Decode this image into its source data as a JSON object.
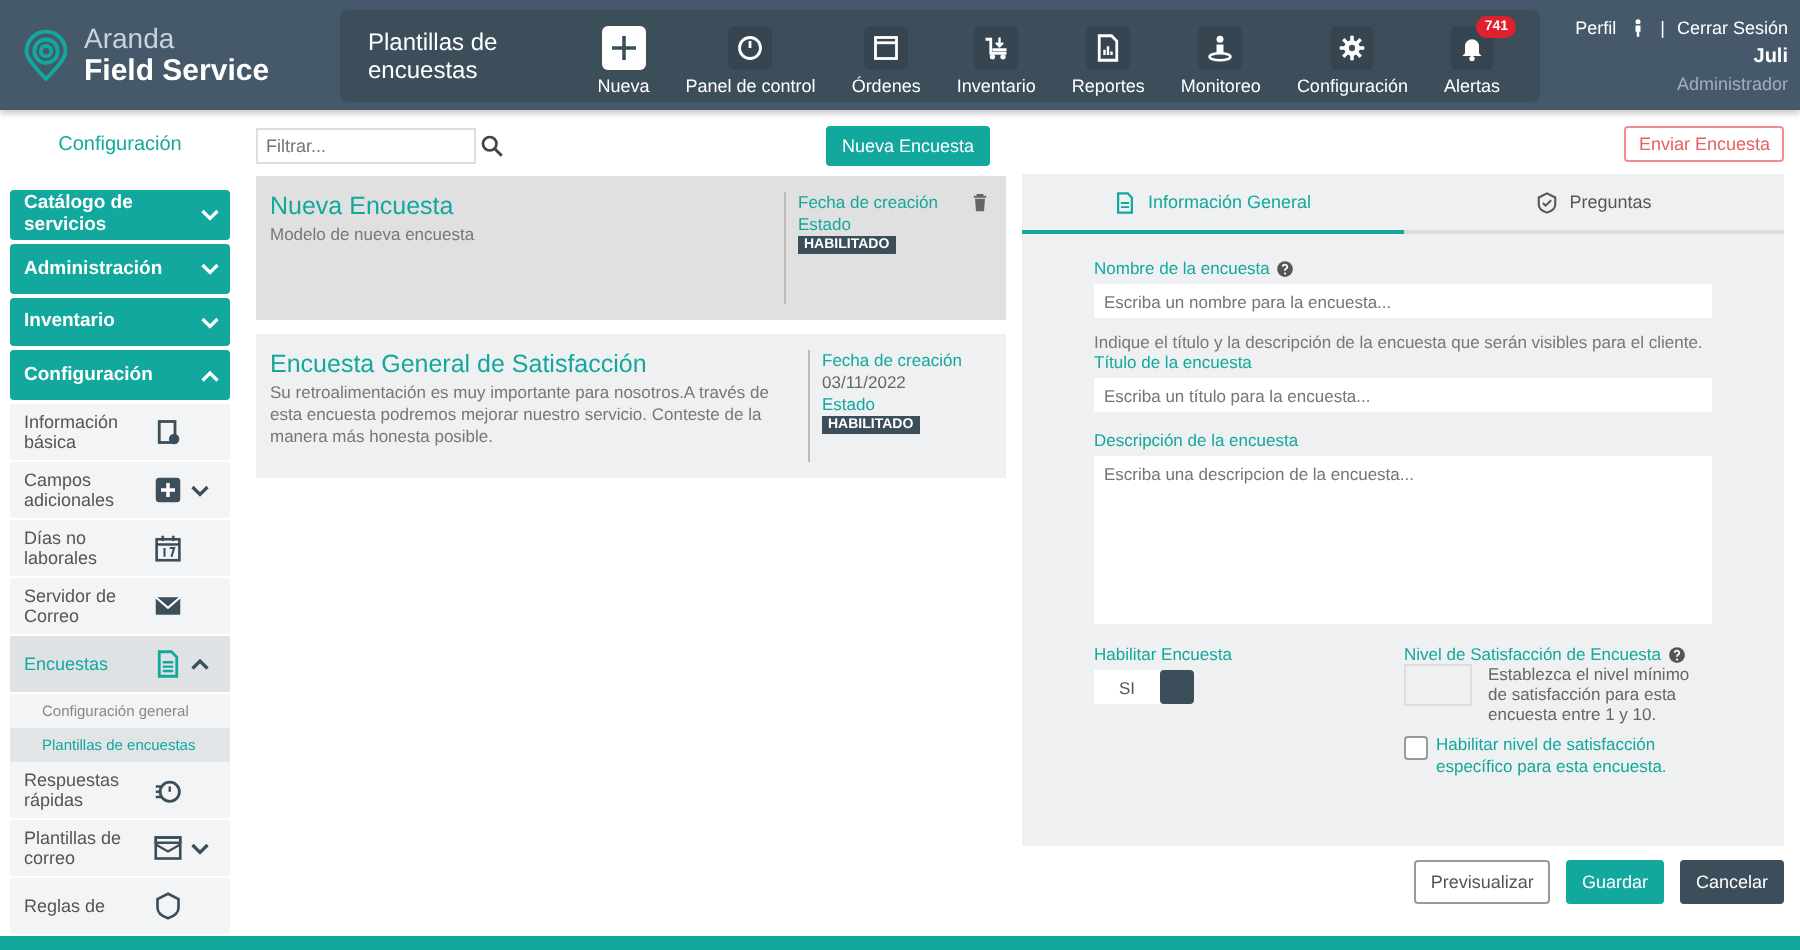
{
  "header": {
    "logo": {
      "line1": "Aranda",
      "line2": "Field Service"
    },
    "page_title": "Plantillas de encuestas",
    "nav": [
      {
        "kind": "add",
        "label": "Nueva"
      },
      {
        "kind": "dashboard",
        "label": "Panel de control"
      },
      {
        "kind": "orders",
        "label": "Órdenes"
      },
      {
        "kind": "inventory",
        "label": "Inventario"
      },
      {
        "kind": "reports",
        "label": "Reportes"
      },
      {
        "kind": "monitor",
        "label": "Monitoreo"
      },
      {
        "kind": "settings",
        "label": "Configuración"
      },
      {
        "kind": "alerts",
        "label": "Alertas",
        "badge": "741"
      }
    ],
    "user": {
      "profile": "Perfil",
      "separator": "|",
      "logout": "Cerrar Sesión",
      "name": "Juli",
      "role": "Administrador"
    }
  },
  "sidebar": {
    "title": "Configuración",
    "sections": [
      {
        "label": "Catálogo de servicios",
        "expanded": false
      },
      {
        "label": "Administración",
        "expanded": false
      },
      {
        "label": "Inventario",
        "expanded": false
      },
      {
        "label": "Configuración",
        "expanded": true,
        "items": [
          {
            "label": "Información básica",
            "kind": "info",
            "selected": false
          },
          {
            "label": "Campos adicionales",
            "kind": "add",
            "selected": false,
            "expanded": false
          },
          {
            "label": "Días no laborales",
            "kind": "calendar",
            "selected": false
          },
          {
            "label": "Servidor de Correo",
            "kind": "mail",
            "selected": false
          },
          {
            "label": "Encuestas",
            "kind": "survey",
            "selected": true,
            "expanded": true,
            "children": [
              {
                "label": "Configuración general",
                "selected": false
              },
              {
                "label": "Plantillas de encuestas",
                "selected": true
              }
            ]
          },
          {
            "label": "Respuestas rápidas",
            "kind": "timer",
            "selected": false
          },
          {
            "label": "Plantillas de correo",
            "kind": "mailtemplate",
            "selected": false,
            "expanded": false
          },
          {
            "label": "Reglas de",
            "kind": "rules",
            "selected": false
          }
        ]
      }
    ]
  },
  "list": {
    "filter": {
      "placeholder": "Filtrar..."
    },
    "new_button": "Nueva Encuesta",
    "cards": [
      {
        "title": "Nueva Encuesta",
        "description": "Modelo de nueva encuesta",
        "created_label": "Fecha de creación",
        "status_label": "Estado",
        "status": "HABILITADO",
        "selected": true
      },
      {
        "title": "Encuesta General de Satisfacción",
        "description": "Su retroalimentación es muy importante para nosotros.A través de esta encuesta podremos mejorar nuestro servicio. Conteste de la manera más honesta posible.",
        "created_label": "Fecha de creación",
        "created_date": "03/11/2022",
        "status_label": "Estado",
        "status": "HABILITADO",
        "selected": false
      }
    ]
  },
  "form": {
    "send_button": "Enviar Encuesta",
    "tabs": [
      {
        "label": "Información General",
        "kind": "doc",
        "selected": true
      },
      {
        "label": "Preguntas",
        "kind": "shield",
        "selected": false
      }
    ],
    "name_label": "Nombre de la encuesta",
    "name_placeholder": "Escriba un nombre para la encuesta...",
    "hint": "Indique el título y la descripción de la encuesta que serán visibles para el cliente.",
    "title_label": "Título de la encuesta",
    "title_placeholder": "Escriba un título para la encuesta...",
    "description_label": "Descripción de la encuesta",
    "description_placeholder": "Escriba una descripcion de la encuesta...",
    "enable_label": "Habilitar Encuesta",
    "enable_toggle": {
      "label": "SI",
      "on": true
    },
    "level_label": "Nivel de Satisfacción de Encuesta",
    "level_help": "Establezca el nivel mínimo de satisfacción para esta encuesta entre 1 y 10.",
    "specific": {
      "label": "Habilitar nivel de satisfacción específico para esta encuesta.",
      "checked": false
    }
  },
  "footer": {
    "buttons": [
      {
        "label": "Previsualizar",
        "kind": "outline"
      },
      {
        "label": "Guardar",
        "kind": "primary"
      },
      {
        "label": "Cancelar",
        "kind": "dark"
      }
    ]
  }
}
